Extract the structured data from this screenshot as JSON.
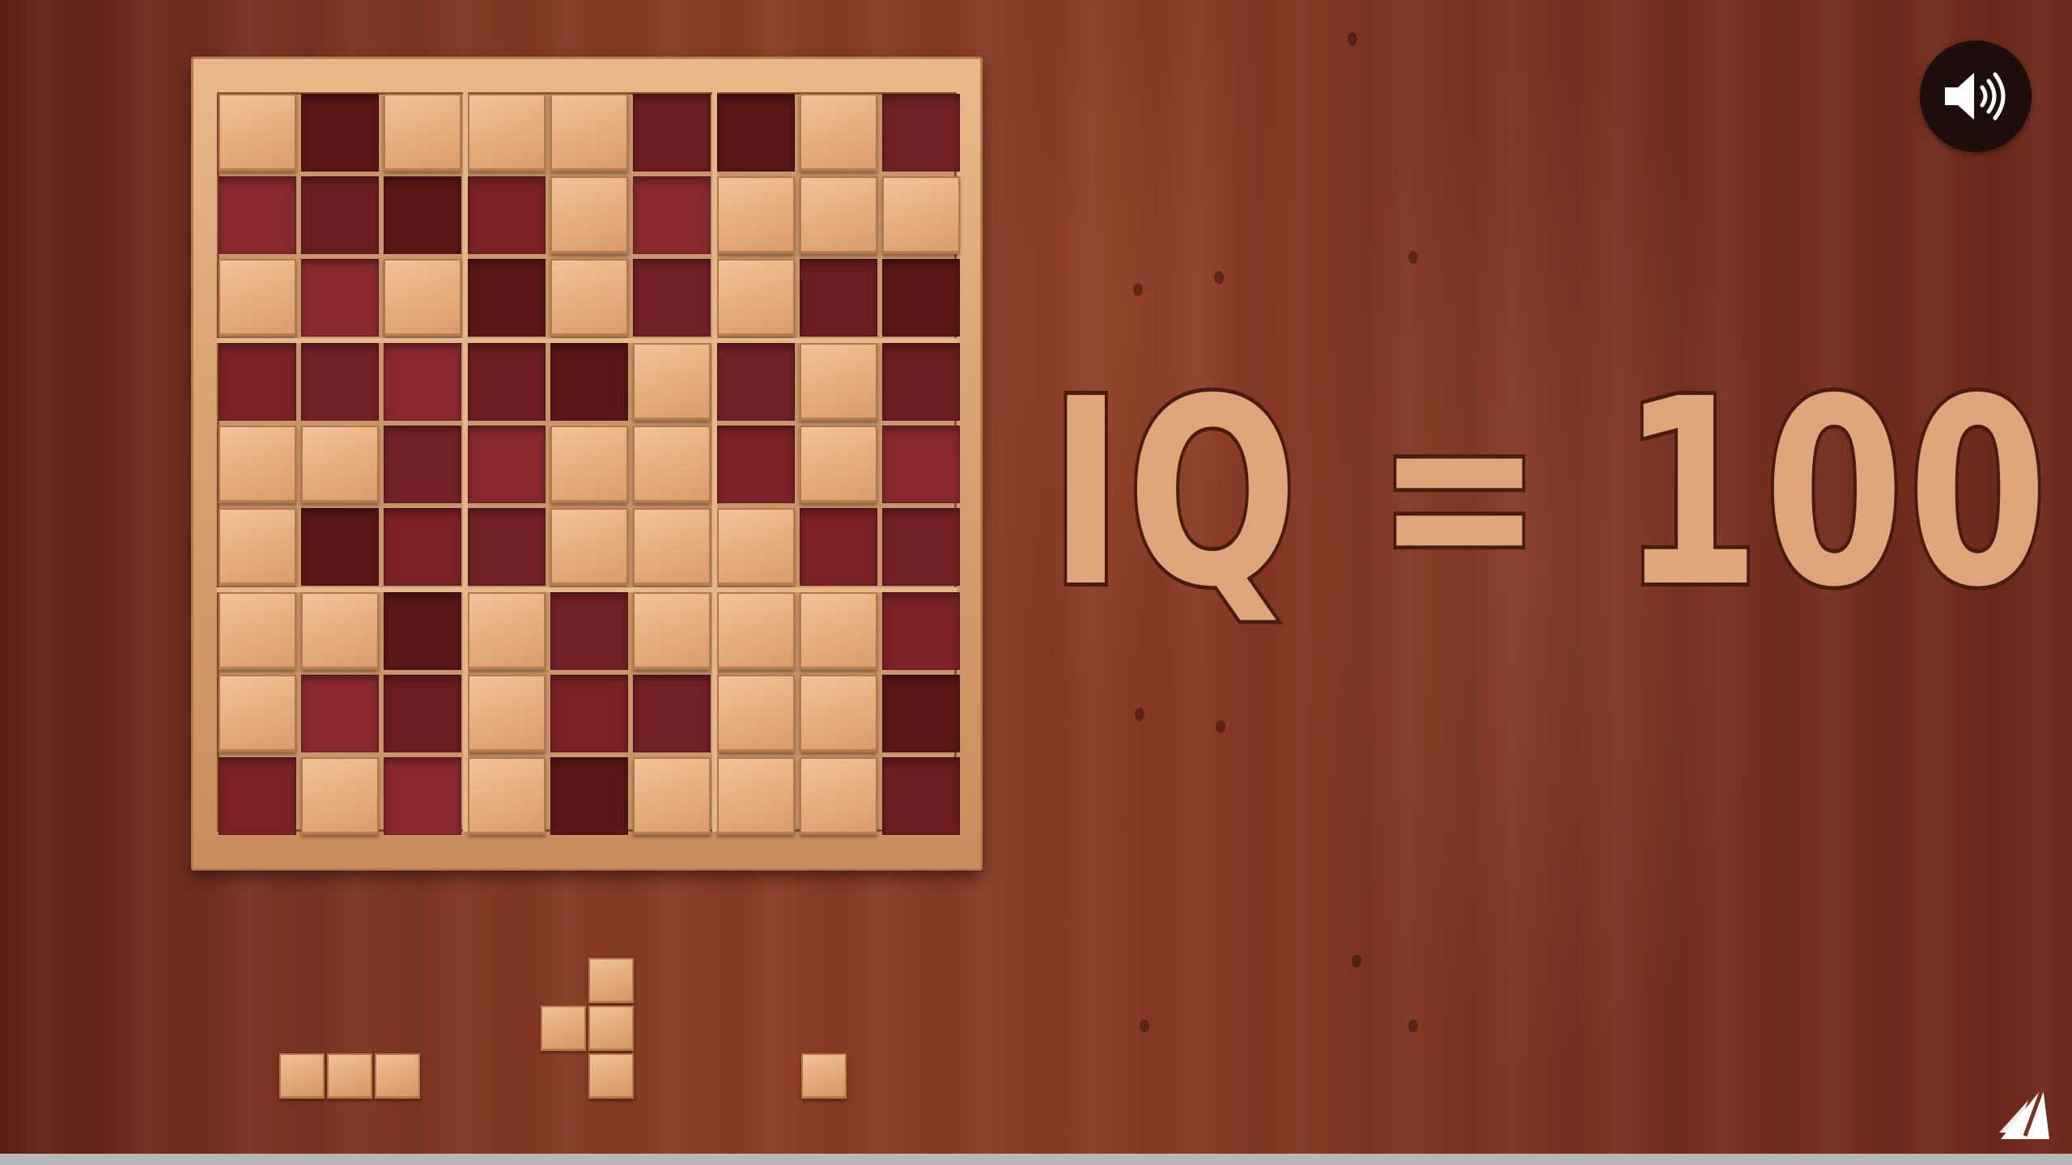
{
  "game": {
    "headline": "IQ = 100",
    "board_size": 9,
    "grid": [
      [
        1,
        0,
        1,
        1,
        1,
        0,
        0,
        1,
        0
      ],
      [
        0,
        0,
        0,
        0,
        1,
        0,
        1,
        1,
        1
      ],
      [
        1,
        0,
        1,
        0,
        1,
        0,
        1,
        0,
        0
      ],
      [
        0,
        0,
        0,
        0,
        0,
        1,
        0,
        1,
        0
      ],
      [
        1,
        1,
        0,
        0,
        1,
        1,
        0,
        1,
        0
      ],
      [
        1,
        0,
        0,
        0,
        1,
        1,
        1,
        0,
        0
      ],
      [
        1,
        1,
        0,
        1,
        0,
        1,
        1,
        1,
        0
      ],
      [
        1,
        0,
        0,
        1,
        0,
        0,
        1,
        1,
        0
      ],
      [
        0,
        1,
        0,
        1,
        0,
        1,
        1,
        1,
        0
      ]
    ],
    "empty_cell_palette": [
      "#6d1d21",
      "#7c2228",
      "#8a2830",
      "#5a1619",
      "#742027"
    ],
    "pieces": [
      {
        "name": "piece-horizontal-3",
        "cells": [
          [
            0,
            0
          ],
          [
            0,
            1
          ],
          [
            0,
            2
          ]
        ]
      },
      {
        "name": "piece-t-shape",
        "cells": [
          [
            0,
            1
          ],
          [
            1,
            0
          ],
          [
            1,
            1
          ],
          [
            2,
            1
          ]
        ]
      },
      {
        "name": "piece-single",
        "cells": [
          [
            0,
            0
          ]
        ]
      }
    ]
  },
  "controls": {
    "sound_icon": "speaker-volume-icon",
    "logo_icon": "sail-logo-icon"
  },
  "colors": {
    "tile": "#e7b081",
    "text_fill": "#dfa57a",
    "text_stroke": "#4a1c10",
    "progress": "#cc1d1d",
    "progress_track": "#b7b7b7"
  },
  "video_progress": 0.0
}
